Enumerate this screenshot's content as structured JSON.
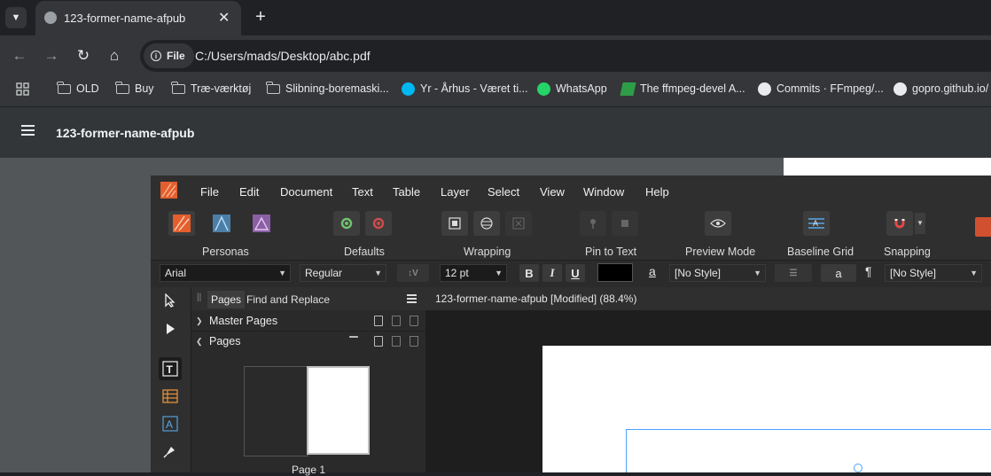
{
  "browser": {
    "tab": {
      "title": "123-former-name-afpub"
    },
    "site_chip": "File",
    "url": "C:/Users/mads/Desktop/abc.pdf",
    "bookmarks": [
      {
        "label": "OLD",
        "icon": "folder-icon"
      },
      {
        "label": "Buy",
        "icon": "folder-icon"
      },
      {
        "label": "Træ-værktøj",
        "icon": "folder-icon"
      },
      {
        "label": "Slibning-boremaski...",
        "icon": "folder-icon"
      },
      {
        "label": "Yr - Århus - Været ti...",
        "icon": "yr-icon"
      },
      {
        "label": "WhatsApp",
        "icon": "whatsapp-icon"
      },
      {
        "label": "The ffmpeg-devel A...",
        "icon": "ffmpeg-icon"
      },
      {
        "label": "Commits · FFmpeg/...",
        "icon": "github-icon"
      },
      {
        "label": "gopro.github.io/",
        "icon": "github-icon"
      }
    ]
  },
  "viewer": {
    "title": "123-former-name-afpub"
  },
  "affinity": {
    "menu": [
      "File",
      "Edit",
      "Document",
      "Text",
      "Table",
      "Layer",
      "Select",
      "View",
      "Window",
      "Help"
    ],
    "ribbon": {
      "personas": "Personas",
      "defaults": "Defaults",
      "wrapping": "Wrapping",
      "pin_to_text": "Pin to Text",
      "preview_mode": "Preview Mode",
      "baseline_grid": "Baseline Grid",
      "snapping": "Snapping"
    },
    "context": {
      "font": "Arial",
      "style": "Regular",
      "size": "12 pt",
      "bold": "B",
      "italic": "I",
      "underline": "U",
      "char_a": "a",
      "char_style": "[No Style]",
      "a_button": "a",
      "pilcrow": "¶",
      "para_style": "[No Style]",
      "text_color": "#000000"
    },
    "panel": {
      "tab_pages": "Pages",
      "tab_find": "Find and Replace",
      "master_pages": "Master Pages",
      "pages": "Pages",
      "page1": "Page 1"
    },
    "document": {
      "title": "123-former-name-afpub [Modified] (88.4%)"
    },
    "accent": "#e45e2e"
  }
}
